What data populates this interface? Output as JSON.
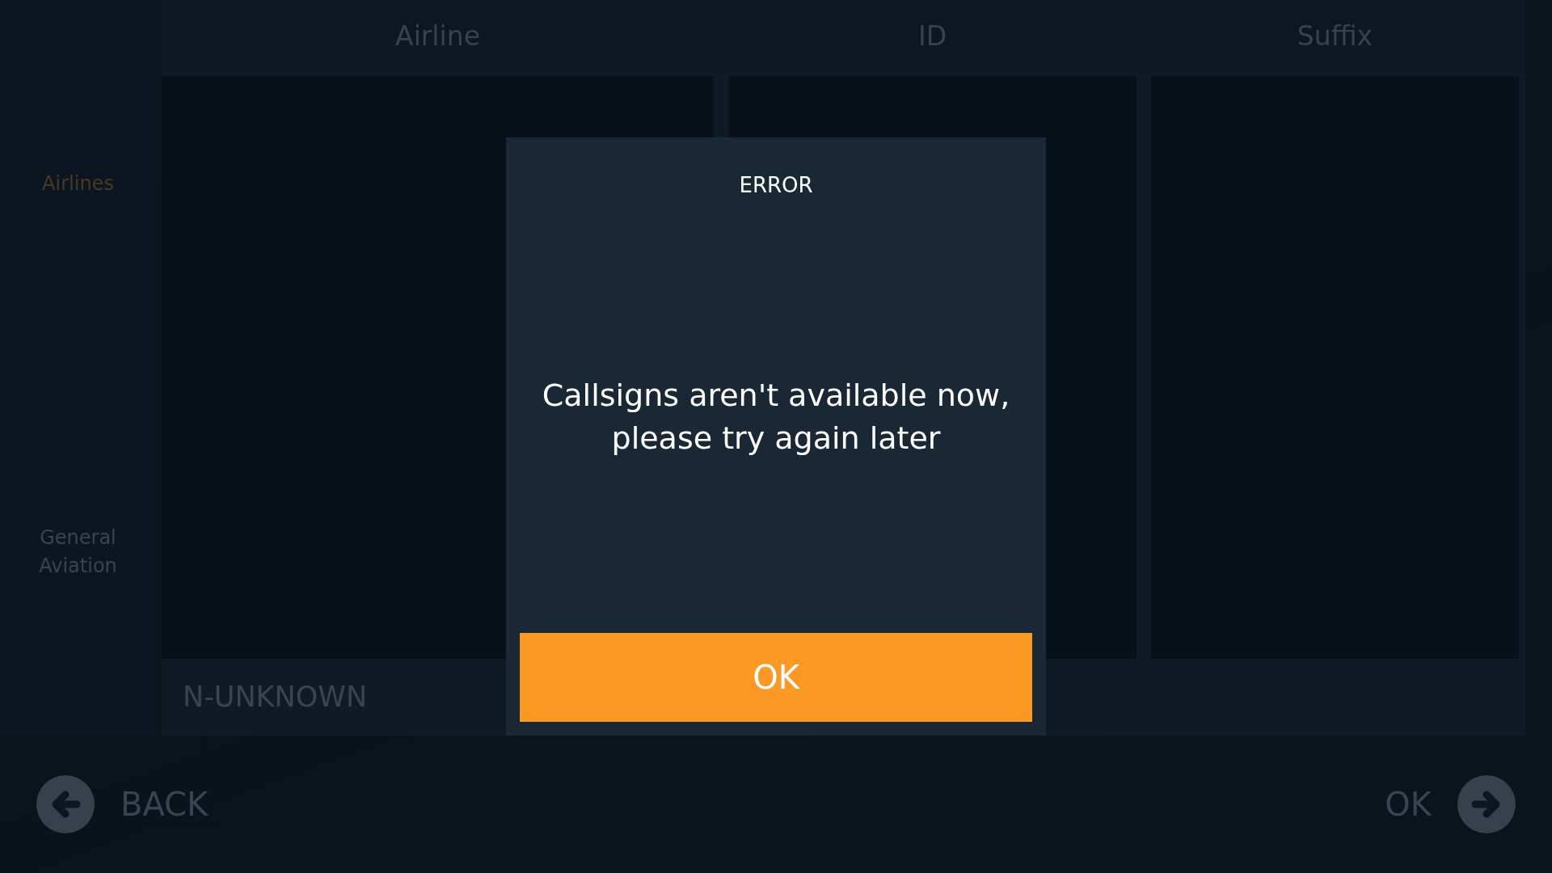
{
  "sidebar": {
    "items": [
      {
        "label": "Airlines",
        "selected": true
      },
      {
        "label": "General Aviation",
        "selected": false
      }
    ]
  },
  "columns": [
    "Airline",
    "ID",
    "Suffix"
  ],
  "callsign_preview": "N-UNKNOWN",
  "nav": {
    "back": "BACK",
    "next": "OK"
  },
  "dialog": {
    "title": "ERROR",
    "message": "Callsigns aren't available now,\nplease try again later",
    "button": "OK"
  }
}
